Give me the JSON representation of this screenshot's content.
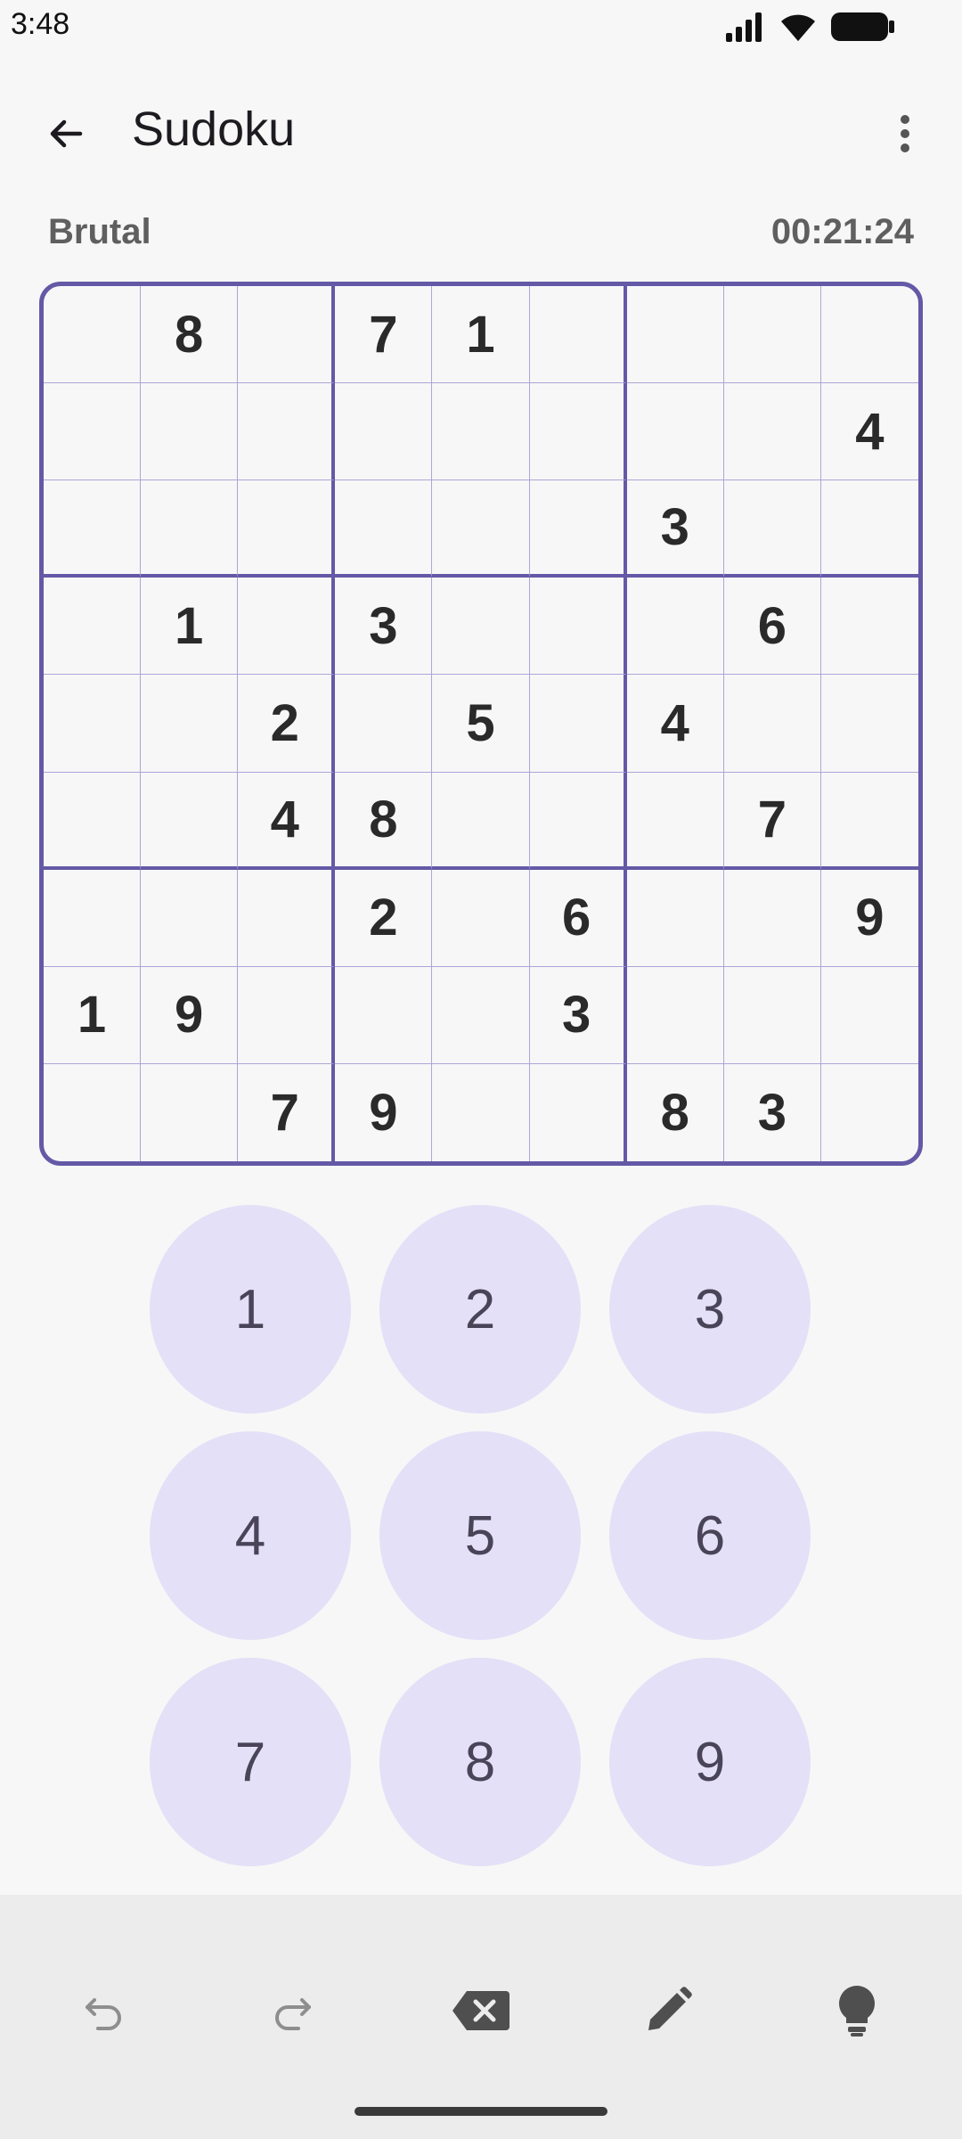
{
  "status_bar": {
    "time": "3:48",
    "icons": [
      "signal-icon",
      "wifi-icon",
      "battery-icon"
    ]
  },
  "app_bar": {
    "title": "Sudoku",
    "back_icon": "arrow-back-icon",
    "more_icon": "more-vert-icon"
  },
  "game": {
    "difficulty": "Brutal",
    "timer": "00:21:24"
  },
  "board": {
    "rows": [
      [
        "",
        "8",
        "",
        "7",
        "1",
        "",
        "",
        "",
        ""
      ],
      [
        "",
        "",
        "",
        "",
        "",
        "",
        "",
        "",
        "4"
      ],
      [
        "",
        "",
        "",
        "",
        "",
        "",
        "3",
        "",
        ""
      ],
      [
        "",
        "1",
        "",
        "3",
        "",
        "",
        "",
        "6",
        ""
      ],
      [
        "",
        "",
        "2",
        "",
        "5",
        "",
        "4",
        "",
        ""
      ],
      [
        "",
        "",
        "4",
        "8",
        "",
        "",
        "",
        "7",
        ""
      ],
      [
        "",
        "",
        "",
        "2",
        "",
        "6",
        "",
        "",
        "9"
      ],
      [
        "1",
        "9",
        "",
        "",
        "",
        "3",
        "",
        "",
        ""
      ],
      [
        "",
        "",
        "7",
        "9",
        "",
        "",
        "8",
        "3",
        ""
      ]
    ]
  },
  "numpad": {
    "keys": [
      "1",
      "2",
      "3",
      "4",
      "5",
      "6",
      "7",
      "8",
      "9"
    ]
  },
  "toolbar": {
    "tools": [
      "undo-icon",
      "redo-icon",
      "erase-icon",
      "pencil-icon",
      "hint-icon"
    ]
  },
  "colors": {
    "accent": "#6459a6",
    "thin_grid": "#aca6d8",
    "key_bg": "#e4e0f7",
    "background": "#f7f7f7",
    "toolbar_bg": "#ececec"
  }
}
